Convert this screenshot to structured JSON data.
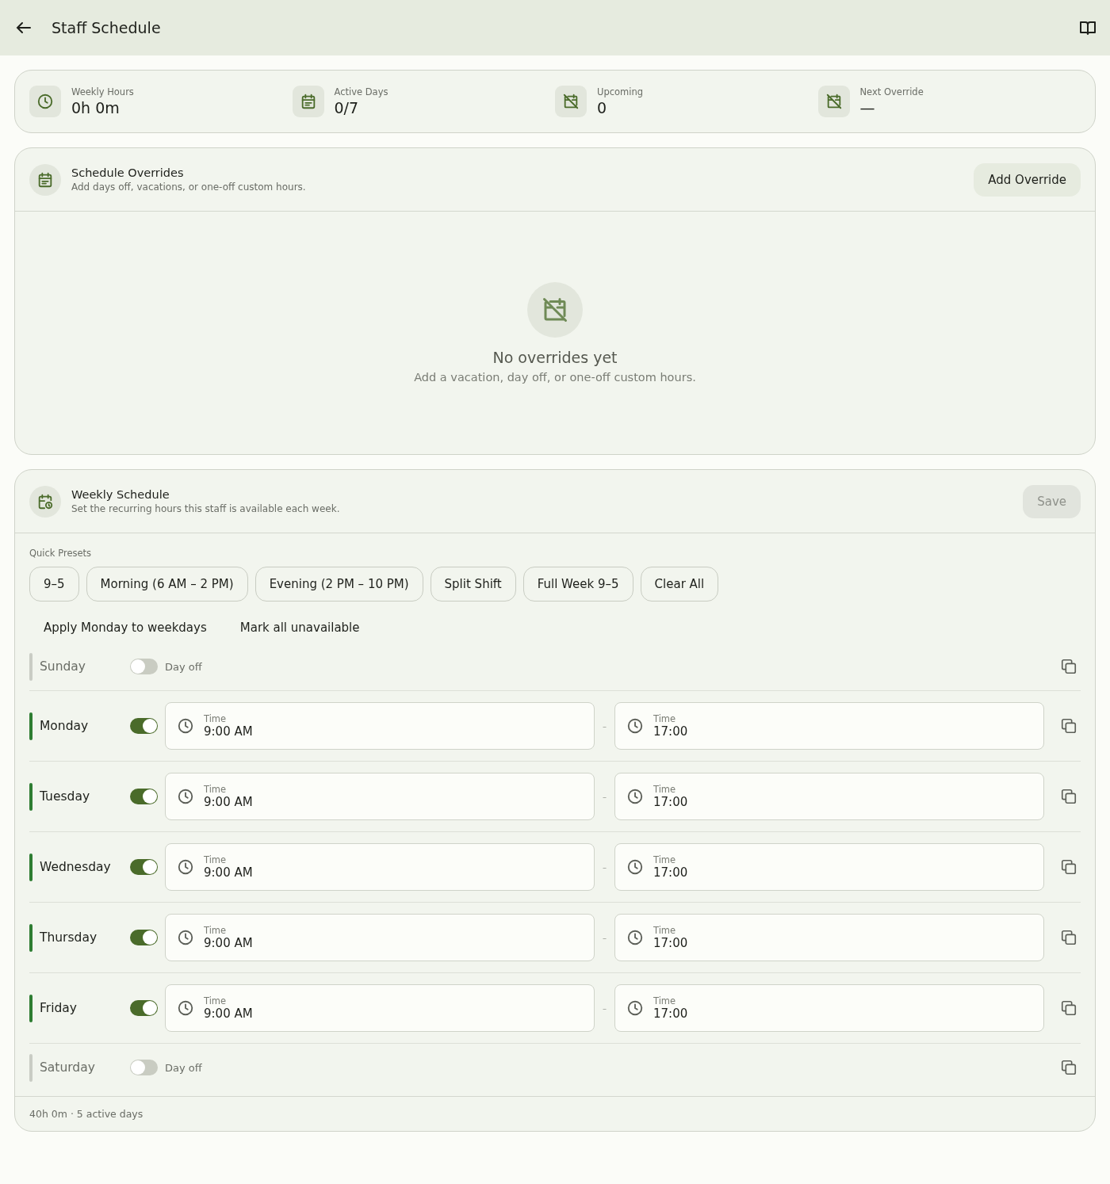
{
  "app_bar": {
    "title": "Staff Schedule"
  },
  "stats": [
    {
      "label": "Weekly Hours",
      "value": "0h 0m"
    },
    {
      "label": "Active Days",
      "value": "0/7"
    },
    {
      "label": "Upcoming",
      "value": "0"
    },
    {
      "label": "Next Override",
      "value": "—"
    }
  ],
  "overrides": {
    "title": "Schedule Overrides",
    "subtitle": "Add days off, vacations, or one-off custom hours.",
    "add_button": "Add Override",
    "empty_title": "No overrides yet",
    "empty_text": "Add a vacation, day off, or one-off custom hours."
  },
  "weekly": {
    "title": "Weekly Schedule",
    "subtitle": "Set the recurring hours this staff is available each week.",
    "save_button": {
      "label": "Save",
      "disabled": true
    },
    "presets_label": "Quick Presets",
    "presets": [
      "9–5",
      "Morning (6 AM – 2 PM)",
      "Evening (2 PM – 10 PM)",
      "Split Shift",
      "Full Week 9–5",
      "Clear All"
    ],
    "actions": [
      "Apply Monday to weekdays",
      "Mark all unavailable"
    ],
    "days": [
      {
        "name": "Sunday",
        "on": false,
        "off_label": "Day off"
      },
      {
        "name": "Monday",
        "on": true,
        "start_label": "Time",
        "start": "9:00 AM",
        "separator": "–",
        "end_label": "Time",
        "end": "17:00"
      },
      {
        "name": "Tuesday",
        "on": true,
        "start_label": "Time",
        "start": "9:00 AM",
        "separator": "–",
        "end_label": "Time",
        "end": "17:00"
      },
      {
        "name": "Wednesday",
        "on": true,
        "start_label": "Time",
        "start": "9:00 AM",
        "separator": "–",
        "end_label": "Time",
        "end": "17:00"
      },
      {
        "name": "Thursday",
        "on": true,
        "start_label": "Time",
        "start": "9:00 AM",
        "separator": "–",
        "end_label": "Time",
        "end": "17:00"
      },
      {
        "name": "Friday",
        "on": true,
        "start_label": "Time",
        "start": "9:00 AM",
        "separator": "–",
        "end_label": "Time",
        "end": "17:00"
      },
      {
        "name": "Saturday",
        "on": false,
        "off_label": "Day off"
      }
    ],
    "footer": "40h 0m · 5 active days"
  }
}
